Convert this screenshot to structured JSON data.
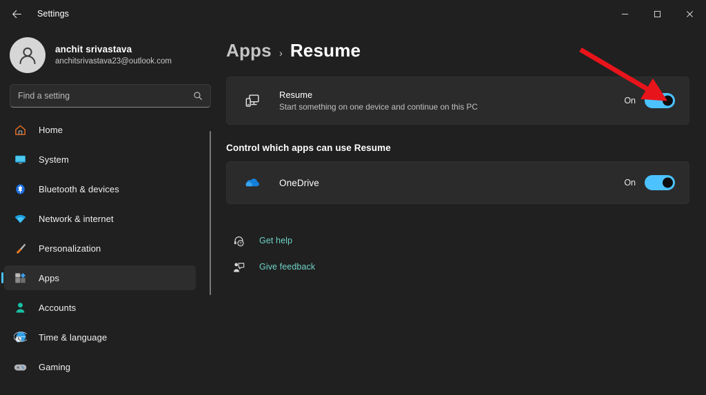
{
  "titlebar": {
    "back_icon": "back-arrow-icon",
    "title": "Settings",
    "minimize_label": "Minimize",
    "maximize_label": "Maximize",
    "close_label": "Close"
  },
  "account": {
    "avatar_icon": "person-avatar-icon",
    "name": "anchit srivastava",
    "email": "anchitsrivastava23@outlook.com"
  },
  "search": {
    "placeholder": "Find a setting",
    "value": "",
    "icon": "search-icon"
  },
  "sidebar": {
    "items": [
      {
        "label": "Home",
        "icon": "home-icon",
        "selected": false
      },
      {
        "label": "System",
        "icon": "monitor-icon",
        "selected": false
      },
      {
        "label": "Bluetooth & devices",
        "icon": "bluetooth-icon",
        "selected": false
      },
      {
        "label": "Network & internet",
        "icon": "wifi-icon",
        "selected": false
      },
      {
        "label": "Personalization",
        "icon": "brush-icon",
        "selected": false
      },
      {
        "label": "Apps",
        "icon": "apps-icon",
        "selected": true
      },
      {
        "label": "Accounts",
        "icon": "account-icon",
        "selected": false
      },
      {
        "label": "Time & language",
        "icon": "clock-globe-icon",
        "selected": false
      },
      {
        "label": "Gaming",
        "icon": "gamepad-icon",
        "selected": false
      }
    ]
  },
  "breadcrumb": {
    "parent": "Apps",
    "separator": "›",
    "current": "Resume"
  },
  "main": {
    "resume_card": {
      "icon": "phone-monitor-icon",
      "title": "Resume",
      "subtitle": "Start something on one device and continue on this PC",
      "toggle_label": "On",
      "toggle_state": "on"
    },
    "section_heading": "Control which apps can use Resume",
    "app_rows": [
      {
        "icon": "onedrive-cloud-icon",
        "name": "OneDrive",
        "toggle_label": "On",
        "toggle_state": "on"
      }
    ],
    "links": [
      {
        "label": "Get help",
        "icon": "headset-help-icon"
      },
      {
        "label": "Give feedback",
        "icon": "feedback-icon"
      }
    ]
  },
  "annotation": {
    "type": "arrow",
    "color": "#e8141b",
    "points_to": "resume-toggle"
  },
  "colors": {
    "accent": "#4cc2ff",
    "page_bg": "#202020",
    "card_bg": "#2b2b2b",
    "link": "#6fd3c8",
    "annotation": "#e8141b"
  }
}
